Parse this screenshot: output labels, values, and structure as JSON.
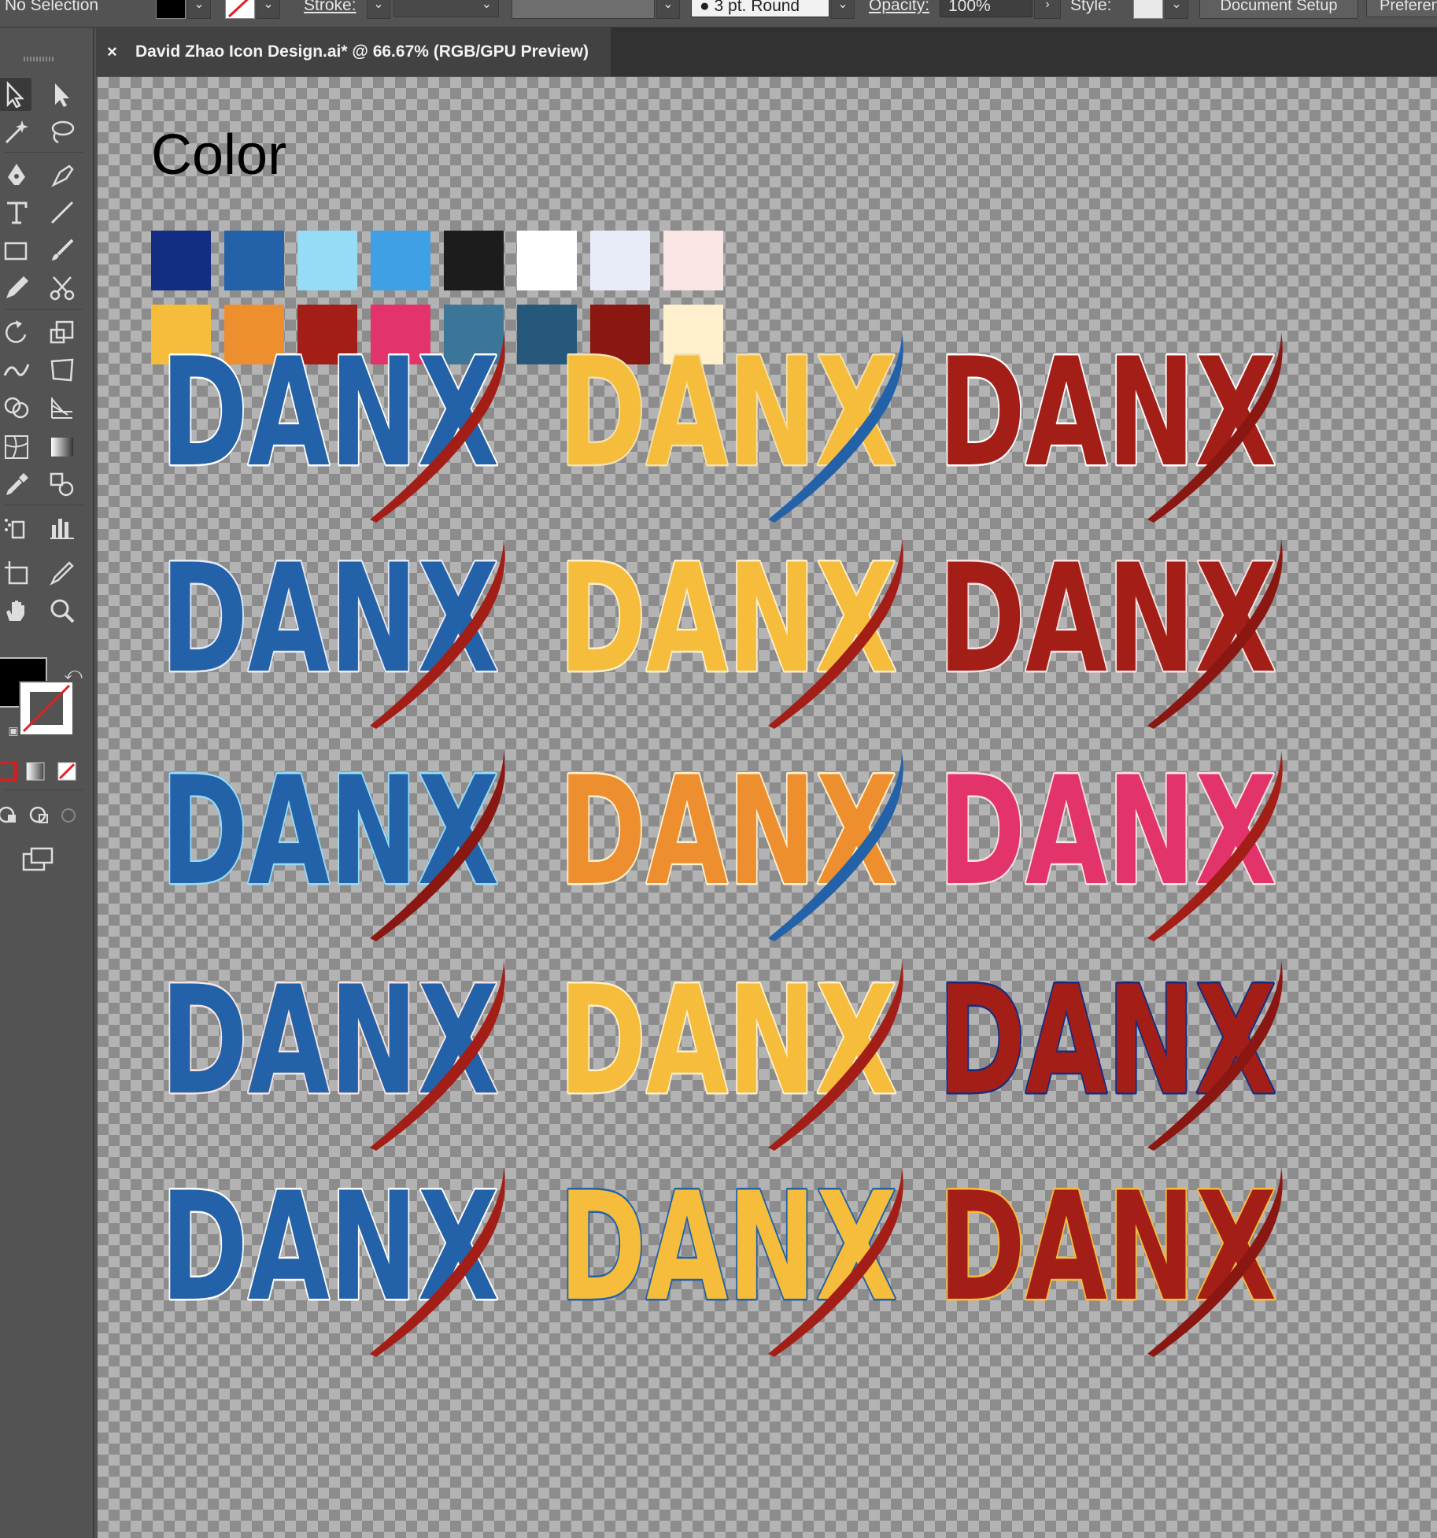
{
  "control_bar": {
    "selection": "No Selection",
    "stroke_label": "Stroke:",
    "brush_value": "3 pt. Round",
    "opacity_label": "Opacity:",
    "opacity_value": "100%",
    "style_label": "Style:",
    "document_setup": "Document Setup",
    "preferences": "Preferen"
  },
  "document": {
    "close_glyph": "×",
    "title": "David Zhao Icon Design.ai* @ 66.67% (RGB/GPU Preview)"
  },
  "artboard": {
    "heading": "Color",
    "palette_row1": [
      "#122d82",
      "#2361a8",
      "#96dcf7",
      "#40a0e6",
      "#1c1c1c",
      "#ffffff",
      "#e8ebf8",
      "#f9e5e3"
    ],
    "palette_row2": [
      "#f5bd3b",
      "#ee8f2f",
      "#a41e18",
      "#e2346a",
      "#3b7699",
      "#25587a",
      "#8a1712",
      "#fff0cd"
    ],
    "logo_text": "DANX",
    "logos": [
      [
        {
          "fill": "#2361a8",
          "stroke": "#ffffff",
          "slash": "#a41e18"
        },
        {
          "fill": "#f5bd3b",
          "stroke": "#f3e2b0",
          "slash": "#2361a8"
        },
        {
          "fill": "#a41e18",
          "stroke": "#ffffff",
          "slash": "#8a1712"
        }
      ],
      [
        {
          "fill": "#2361a8",
          "stroke": "#e8ebf8",
          "slash": "#a41e18"
        },
        {
          "fill": "#f5bd3b",
          "stroke": "#fff0cd",
          "slash": "#a41e18"
        },
        {
          "fill": "#a41e18",
          "stroke": "#f9e5e3",
          "slash": "#8a1712"
        }
      ],
      [
        {
          "fill": "#2361a8",
          "stroke": "#96dcf7",
          "slash": "#8a1712"
        },
        {
          "fill": "#ee8f2f",
          "stroke": "#fff0cd",
          "slash": "#2361a8"
        },
        {
          "fill": "#e2346a",
          "stroke": "#f9e5e3",
          "slash": "#a41e18"
        }
      ],
      [
        {
          "fill": "#2361a8",
          "stroke": "#f9e5e3",
          "slash": "#a41e18"
        },
        {
          "fill": "#f5bd3b",
          "stroke": "#fff0cd",
          "slash": "#a41e18"
        },
        {
          "fill": "#a41e18",
          "stroke": "#122d82",
          "slash": "#8a1712"
        }
      ],
      [
        {
          "fill": "#2361a8",
          "stroke": "#ffffff",
          "slash": "#a41e18"
        },
        {
          "fill": "#f5bd3b",
          "stroke": "#2361a8",
          "slash": "#a41e18"
        },
        {
          "fill": "#a41e18",
          "stroke": "#f5bd3b",
          "slash": "#8a1712"
        }
      ]
    ]
  },
  "toolbar": {
    "tools": [
      "selection-tool",
      "direct-selection-tool",
      "magic-wand-tool",
      "lasso-tool",
      "pen-tool",
      "curvature-tool",
      "type-tool",
      "line-segment-tool",
      "rectangle-tool",
      "paintbrush-tool",
      "pencil-tool",
      "scissors-tool",
      "rotate-tool",
      "scale-tool",
      "width-tool",
      "free-transform-tool",
      "shape-builder-tool",
      "perspective-grid-tool",
      "mesh-tool",
      "gradient-tool",
      "eyedropper-tool",
      "blend-tool",
      "symbol-sprayer-tool",
      "column-graph-tool",
      "artboard-tool",
      "slice-tool",
      "hand-tool",
      "zoom-tool"
    ],
    "fill_color": "#000000",
    "stroke_color": "none"
  }
}
